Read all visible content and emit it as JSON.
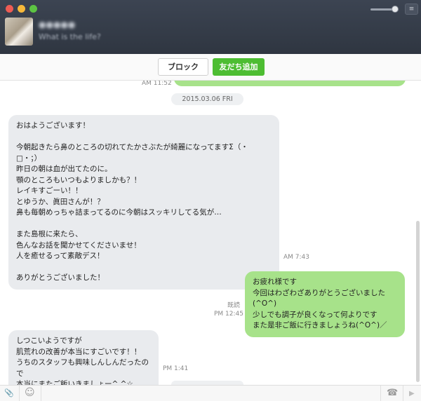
{
  "header": {
    "contact_name": "●●●●●",
    "status_message": "What is the life?",
    "menu_icon": "≡"
  },
  "actions": {
    "block_label": "ブロック",
    "add_friend_label": "友だち追加"
  },
  "messages": [
    {
      "time": "AM 11:52"
    },
    {
      "date": "2015.03.06 FRI"
    },
    {
      "text": "おはようございます！\n\n今朝起きたら鼻のところの切れてたかさぶたが綺麗になってますΣ（・□・；）\n昨日の朝は血が出てたのに。\n顎のところもいつもよりましかも？！\nレイキすごーい！！\nとゆうか、眞田さんが！？\n鼻も毎朝めっちゃ詰まってるのに今朝はスッキリしてる気が…\n\nまた島根に来たら、\n色んなお話を聞かせてくださいませ！\n人を癒せるって素敵デス！\n\nありがとうございました！",
      "time": "AM 7:43"
    },
    {
      "text": "お疲れ様です\n今回はわざわざありがとうございました(^O^)\n少しでも調子が良くなって何よりです\nまた是非ご飯に行きましょうね(^O^)／",
      "read": "既読",
      "time": "PM 12:45"
    },
    {
      "text": "しつこいようですが\n肌荒れの改善が本当にすごいです！！\nうちのスタッフも興味しんしんだったので\n本当にまたご飯いきましょー^ ^☆",
      "time": "PM 1:41"
    }
  ],
  "input_bar": {
    "attach_icon": "📎",
    "emoji_icon": "☺",
    "call_icon": "☎",
    "send_icon": "▶"
  },
  "colors": {
    "header_bg": "#353c48",
    "outgoing_bubble": "#a7e28a",
    "incoming_bubble": "#e9ebee",
    "add_friend_button": "#4dbd32"
  }
}
